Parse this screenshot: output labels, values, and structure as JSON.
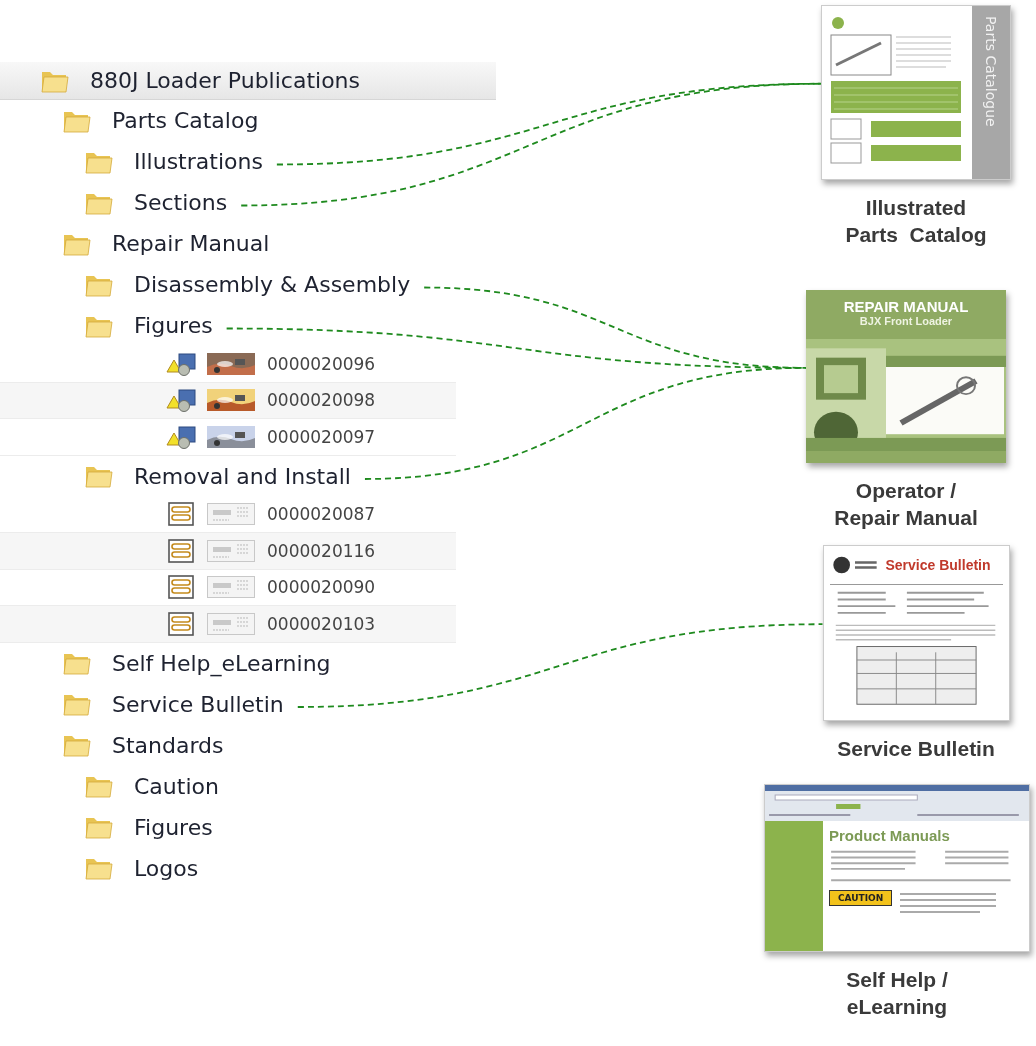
{
  "tree": [
    {
      "label": "880J Loader Publications",
      "selected": true,
      "children": [
        {
          "label": "Parts Catalog",
          "selected": false,
          "children": [
            {
              "label": "Illustrations",
              "selected": false
            },
            {
              "label": "Sections",
              "selected": false
            }
          ]
        },
        {
          "label": "Repair Manual",
          "selected": false,
          "children": [
            {
              "label": "Disassembly & Assembly",
              "selected": false
            },
            {
              "label": "Figures",
              "selected": false,
              "files": [
                {
                  "kind": "figure",
                  "label": "0000020096"
                },
                {
                  "kind": "figure",
                  "label": "0000020098"
                },
                {
                  "kind": "figure",
                  "label": "0000020097"
                }
              ]
            },
            {
              "label": "Removal and Install",
              "selected": false,
              "files": [
                {
                  "kind": "procedure",
                  "label": "0000020087"
                },
                {
                  "kind": "procedure",
                  "label": "0000020116"
                },
                {
                  "kind": "procedure",
                  "label": "0000020090"
                },
                {
                  "kind": "procedure",
                  "label": "0000020103"
                }
              ]
            }
          ]
        },
        {
          "label": "Self Help_eLearning",
          "selected": false
        },
        {
          "label": "Service Bulletin",
          "selected": false
        },
        {
          "label": "Standards",
          "selected": false,
          "children": [
            {
              "label": "Caution",
              "selected": false
            },
            {
              "label": "Figures",
              "selected": false
            },
            {
              "label": "Logos",
              "selected": false
            }
          ]
        }
      ]
    }
  ],
  "documents": [
    {
      "kind": "catalog",
      "texts": [
        "Parts Catalogue"
      ],
      "caption": [
        "Illustrated",
        "Parts  Catalog"
      ]
    },
    {
      "kind": "manual",
      "texts": [
        "REPAIR MANUAL",
        "BJX Front Loader"
      ],
      "caption": [
        "Operator /",
        "Repair Manual"
      ]
    },
    {
      "kind": "bulletin",
      "texts": [
        "Service Bulletin"
      ],
      "caption": [
        "Service Bulletin"
      ]
    },
    {
      "kind": "webpage",
      "texts": [
        "Product Manuals",
        "CAUTION"
      ],
      "caption": [
        "Self Help /",
        "eLearning"
      ]
    }
  ]
}
